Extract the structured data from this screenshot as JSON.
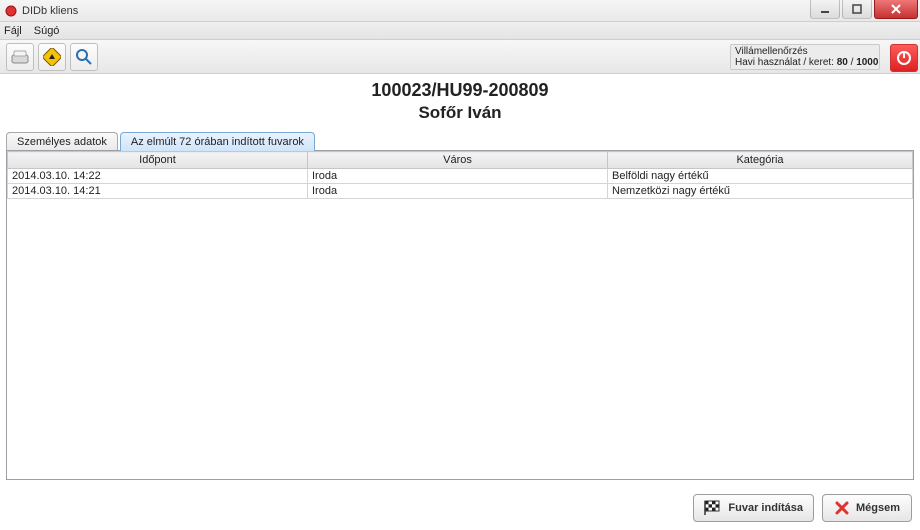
{
  "window": {
    "title": "DIDb kliens"
  },
  "menu": {
    "file": "Fájl",
    "help": "Súgó"
  },
  "toolbar": {
    "icons": {
      "scanner": "scanner-icon",
      "sign": "sign-icon",
      "search": "search-icon"
    }
  },
  "usage": {
    "line1": "Villámellenőrzés",
    "line2_prefix": "Havi használat / keret: ",
    "used": "80",
    "sep": " / ",
    "limit": "1000"
  },
  "record": {
    "id": "100023/HU99-200809",
    "name": "Sofőr Iván"
  },
  "tabs": {
    "personal": "Személyes adatok",
    "recent": "Az elmúlt 72 órában indított fuvarok"
  },
  "grid": {
    "headers": {
      "time": "Időpont",
      "city": "Város",
      "category": "Kategória"
    },
    "rows": [
      {
        "time": "2014.03.10. 14:22",
        "city": "Iroda",
        "category": "Belföldi nagy értékű"
      },
      {
        "time": "2014.03.10. 14:21",
        "city": "Iroda",
        "category": "Nemzetközi nagy értékű"
      }
    ]
  },
  "buttons": {
    "start": "Fuvar indítása",
    "cancel": "Mégsem"
  }
}
